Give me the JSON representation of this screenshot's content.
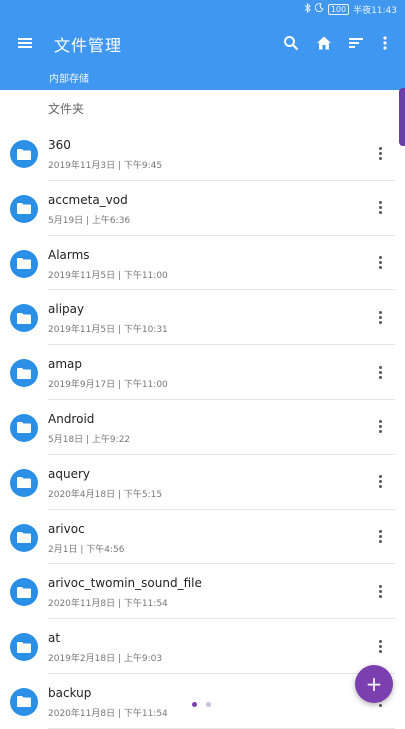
{
  "status_bar": {
    "icons": [
      "bluetooth-icon",
      "moon-icon",
      "battery-icon"
    ],
    "battery": "100",
    "time": "半夜11:43"
  },
  "app_bar": {
    "title": "文件管理",
    "path": "内部存储"
  },
  "section_label": "文件夹",
  "colors": {
    "primary": "#3f97ef",
    "folder": "#2b8fe5",
    "fab": "#7c3fb0"
  },
  "files": [
    {
      "name": "360",
      "date": "2019年11月3日 | 下午9:45"
    },
    {
      "name": "accmeta_vod",
      "date": "5月19日 | 上午6:36"
    },
    {
      "name": "Alarms",
      "date": "2019年11月5日 | 下午11:00"
    },
    {
      "name": "alipay",
      "date": "2019年11月5日 | 下午10:31"
    },
    {
      "name": "amap",
      "date": "2019年9月17日 | 下午11:00"
    },
    {
      "name": "Android",
      "date": "5月18日 | 上午9:22"
    },
    {
      "name": "aquery",
      "date": "2020年4月18日 | 下午5:15"
    },
    {
      "name": "arivoc",
      "date": "2月1日 | 下午4:56"
    },
    {
      "name": "arivoc_twomin_sound_file",
      "date": "2020年11月8日 | 下午11:54"
    },
    {
      "name": "at",
      "date": "2019年2月18日 | 上午9:03"
    },
    {
      "name": "backup",
      "date": "2020年11月8日 | 下午11:54"
    }
  ],
  "fab_label": "+"
}
